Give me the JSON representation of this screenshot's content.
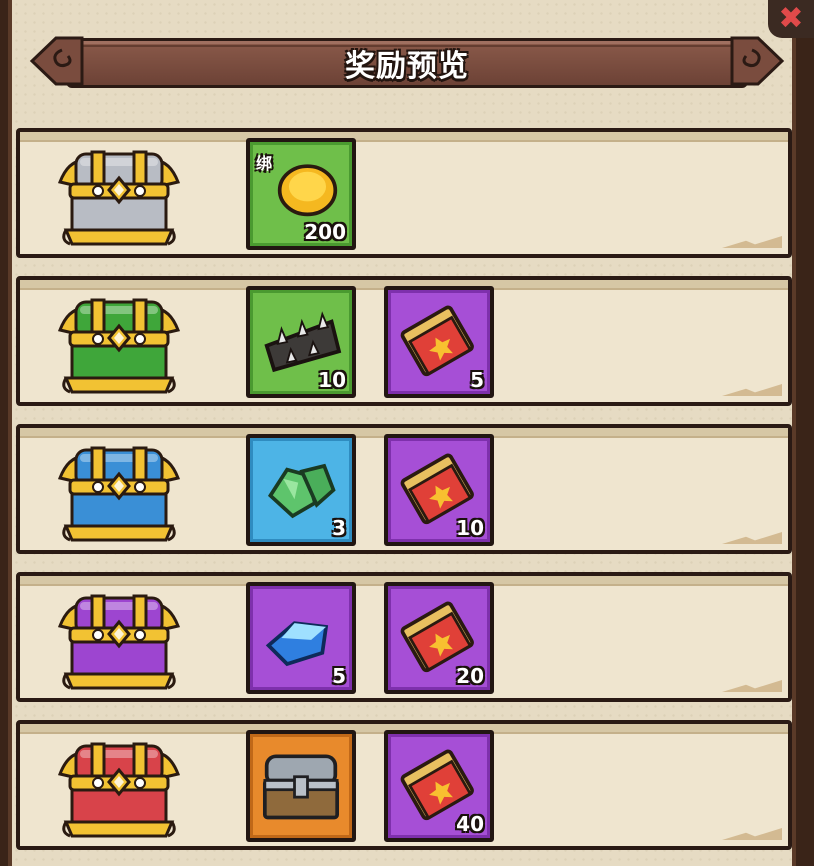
{
  "title": "奖励预览",
  "rows": [
    {
      "chest_color": "#b8bcc4",
      "chest_icon": "silver-chest-icon",
      "rewards": [
        {
          "icon": "gold-coin-icon",
          "tag": "绑",
          "count": "200",
          "bg": "green"
        }
      ]
    },
    {
      "chest_color": "#3fa63a",
      "chest_icon": "green-chest-icon",
      "rewards": [
        {
          "icon": "spiked-armor-icon",
          "count": "10",
          "bg": "green"
        },
        {
          "icon": "red-ticket-icon",
          "count": "5",
          "bg": "purple"
        }
      ]
    },
    {
      "chest_color": "#3a8fd6",
      "chest_icon": "blue-chest-icon",
      "rewards": [
        {
          "icon": "green-ore-icon",
          "count": "3",
          "bg": "blue"
        },
        {
          "icon": "red-ticket-icon",
          "count": "10",
          "bg": "purple"
        }
      ]
    },
    {
      "chest_color": "#9d45d0",
      "chest_icon": "purple-chest-icon",
      "rewards": [
        {
          "icon": "blue-crystal-icon",
          "count": "5",
          "bg": "purple"
        },
        {
          "icon": "red-ticket-icon",
          "count": "20",
          "bg": "purple"
        }
      ]
    },
    {
      "chest_color": "#d8434a",
      "chest_icon": "red-chest-icon",
      "rewards": [
        {
          "icon": "iron-chest-icon",
          "count": "",
          "bg": "orange"
        },
        {
          "icon": "red-ticket-icon",
          "count": "40",
          "bg": "purple"
        }
      ]
    }
  ]
}
